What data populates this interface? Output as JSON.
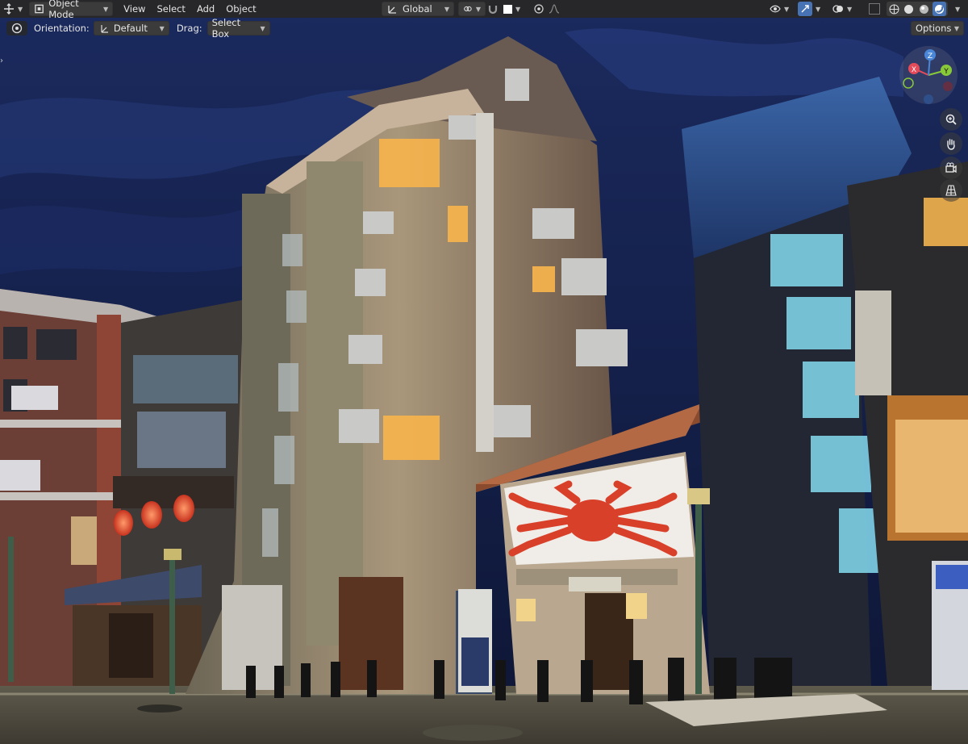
{
  "app": {
    "name": "Blender"
  },
  "header": {
    "mode_label": "Object Mode",
    "menus": [
      "View",
      "Select",
      "Add",
      "Object"
    ],
    "transform_orientation": "Global"
  },
  "tool_header": {
    "orientation_label": "Orientation:",
    "orientation_value": "Default",
    "drag_label": "Drag:",
    "drag_value": "Select Box",
    "options_label": "Options"
  },
  "gizmo": {
    "axes": [
      {
        "label": "X",
        "color": "#e34b5b"
      },
      {
        "label": "Y",
        "color": "#88c93a"
      },
      {
        "label": "Z",
        "color": "#4a86d8"
      }
    ]
  },
  "scene": {
    "icons": [
      "crab-sign",
      "red-lanterns",
      "street-lamps",
      "air-conditioners",
      "bollards",
      "vending-machine"
    ]
  },
  "colors": {
    "header_bg": "#282828",
    "widget_bg": "#3b3b3b",
    "active_blue": "#4772b3",
    "sky": "#14204a"
  }
}
